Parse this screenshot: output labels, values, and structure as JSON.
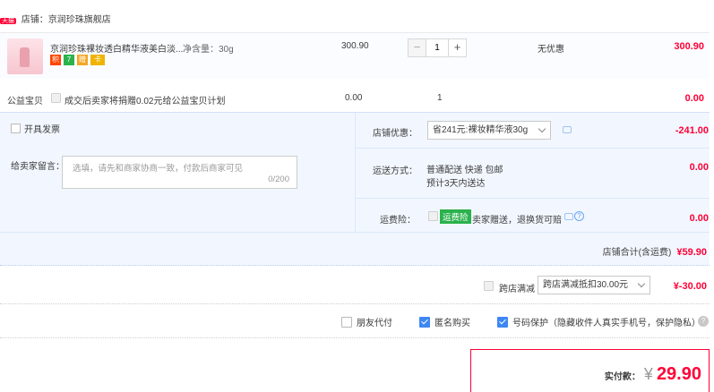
{
  "shop": {
    "tag": "天猫",
    "label": "店铺：",
    "name": "京润珍珠旗舰店"
  },
  "item": {
    "title": "京润珍珠裸妆透白精华液美白淡...",
    "spec": "净含量：30g",
    "price": "300.90",
    "quantity": "1",
    "promo": "无优惠",
    "subtotal": "300.90",
    "badges": [
      "积",
      "7",
      "赠",
      "卡"
    ]
  },
  "charity": {
    "label": "公益宝贝",
    "text": "成交后卖家将捐赠0.02元给公益宝贝计划",
    "price": "0.00",
    "qty": "1",
    "total": "0.00"
  },
  "invoice": {
    "label": "开具发票"
  },
  "message": {
    "label": "给卖家留言：",
    "placeholder": "选填，请先和商家协商一致，付款后商家可见",
    "counter": "0/200"
  },
  "shop_discount": {
    "label": "店铺优惠：",
    "selected": "省241元:裸妆精华液30g",
    "amount": "-241.00"
  },
  "shipping": {
    "label": "运送方式：",
    "method": "普通配送 快递 包邮",
    "eta": "预计3天内送达",
    "amount": "0.00"
  },
  "insurance": {
    "label": "运费险：",
    "badge": "运费险",
    "text": "卖家赠送，退换货可赔",
    "amount": "0.00"
  },
  "shop_total": {
    "label": "店铺合计(含运费)",
    "amount": "¥59.90"
  },
  "cross_store": {
    "label": "跨店满减",
    "selected": "跨店满减抵扣30.00元",
    "amount": "¥-30.00"
  },
  "options": {
    "friend_pay": "朋友代付",
    "anonymous": "匿名购买",
    "privacy": "号码保护（隐藏收件人真实手机号，保护隐私）"
  },
  "payment": {
    "label": "实付款：",
    "currency": "¥",
    "amount": "29.90"
  },
  "colors": {
    "accent": "#ff0036",
    "blue": "#3d87f5",
    "panel": "#f2f7ff"
  }
}
